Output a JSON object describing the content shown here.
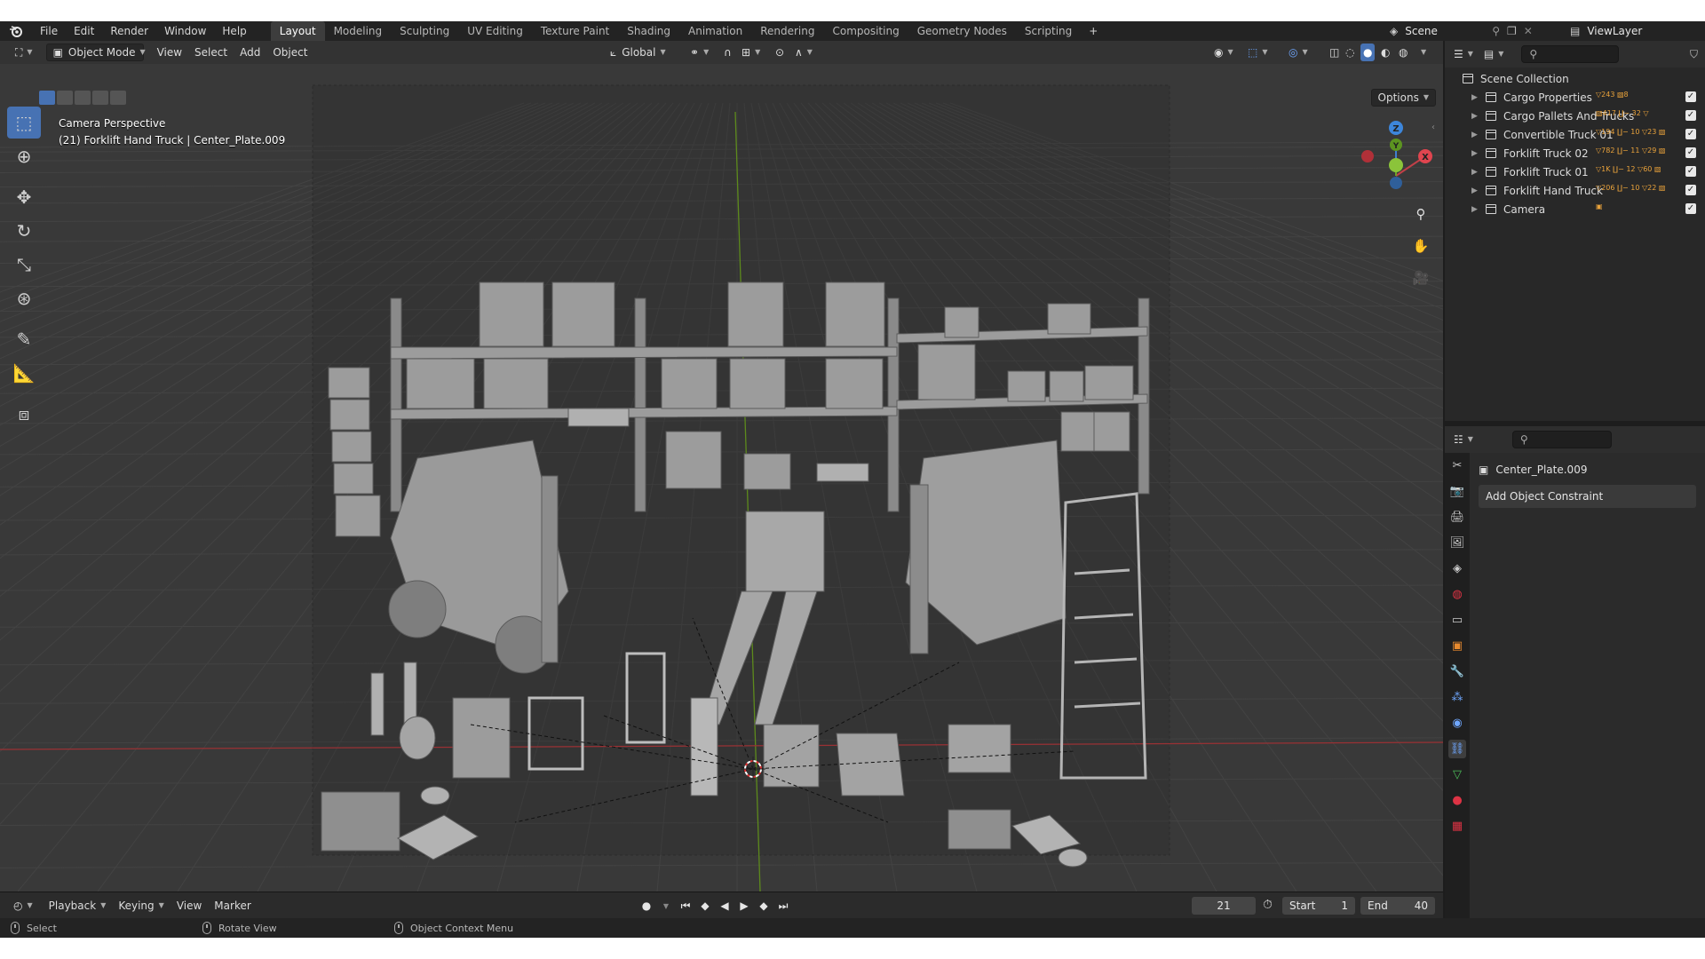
{
  "topbar": {
    "menus": [
      "File",
      "Edit",
      "Render",
      "Window",
      "Help"
    ],
    "workspaces": [
      "Layout",
      "Modeling",
      "Sculpting",
      "UV Editing",
      "Texture Paint",
      "Shading",
      "Animation",
      "Rendering",
      "Compositing",
      "Geometry Nodes",
      "Scripting"
    ],
    "active_workspace": "Layout",
    "add_tab": "+",
    "scene": "Scene",
    "view_layer": "ViewLayer"
  },
  "viewport": {
    "mode": "Object Mode",
    "menus": [
      "View",
      "Select",
      "Add",
      "Object"
    ],
    "orientation": "Global",
    "options_label": "Options",
    "overlay_line1": "Camera Perspective",
    "overlay_line2": "(21) Forklift Hand Truck | Center_Plate.009",
    "axis_x": "X",
    "axis_y": "Y",
    "axis_z": "Z",
    "colors": {
      "background": "#393939",
      "grid": "#444444",
      "x_axis": "#a8383c",
      "y_axis": "#6a9a1e",
      "camera_frame": "#2f2f2f"
    }
  },
  "outliner": {
    "root": "Scene Collection",
    "items": [
      {
        "label": "Cargo Properties",
        "badges": "▽243 ▧8"
      },
      {
        "label": "Cargo Pallets And Trucks",
        "badges": "▧417 ∐− 32 ▽"
      },
      {
        "label": "Convertible Truck 01",
        "badges": "▽194 ∐− 10 ▽23 ▧"
      },
      {
        "label": "Forklift Truck 02",
        "badges": "▽782 ∐− 11 ▽29 ▧"
      },
      {
        "label": "Forklift Truck 01",
        "badges": "▽1K ∐− 12 ▽60 ▧"
      },
      {
        "label": "Forklift Hand Truck",
        "badges": "▽206 ∐− 10 ▽22 ▧"
      },
      {
        "label": "Camera",
        "badges": "▣"
      }
    ]
  },
  "properties": {
    "object_name": "Center_Plate.009",
    "add_constraint_label": "Add Object Constraint"
  },
  "timeline": {
    "menus": [
      "Playback",
      "Keying",
      "View",
      "Marker"
    ],
    "current_frame": "21",
    "start_label": "Start",
    "start_value": "1",
    "end_label": "End",
    "end_value": "40"
  },
  "statusbar": {
    "left": "Select",
    "middle": "Rotate View",
    "right": "Object Context Menu"
  }
}
